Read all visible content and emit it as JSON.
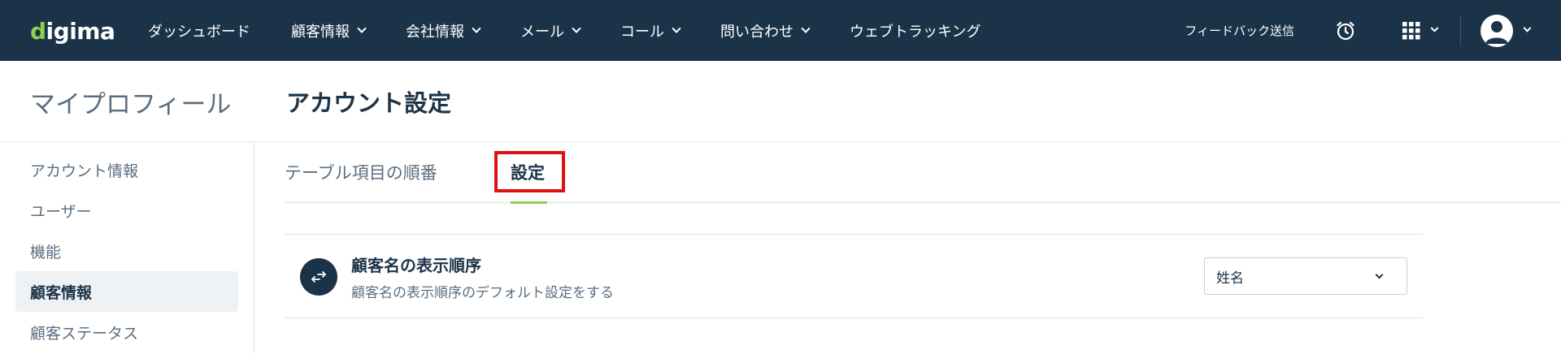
{
  "app": {
    "logo_prefix": "d",
    "logo_rest": "igima"
  },
  "topnav": {
    "items": [
      {
        "label": "ダッシュボード",
        "dropdown": false
      },
      {
        "label": "顧客情報",
        "dropdown": true
      },
      {
        "label": "会社情報",
        "dropdown": true
      },
      {
        "label": "メール",
        "dropdown": true
      },
      {
        "label": "コール",
        "dropdown": true
      },
      {
        "label": "問い合わせ",
        "dropdown": true
      },
      {
        "label": "ウェブトラッキング",
        "dropdown": false
      }
    ],
    "feedback_label": "フィードバック送信",
    "icons": {
      "alarm": "alarm-clock-icon",
      "apps": "grid-apps-icon",
      "avatar": "user-avatar-icon"
    }
  },
  "header": {
    "section_title": "マイプロフィール",
    "page_title": "アカウント設定"
  },
  "sidebar": {
    "items": [
      {
        "label": "アカウント情報",
        "active": false
      },
      {
        "label": "ユーザー",
        "active": false
      },
      {
        "label": "機能",
        "active": false
      },
      {
        "label": "顧客情報",
        "active": true
      },
      {
        "label": "顧客ステータス",
        "active": false
      }
    ]
  },
  "tabs": {
    "items": [
      {
        "label": "テーブル項目の順番",
        "active": false
      },
      {
        "label": "設定",
        "active": true
      }
    ]
  },
  "setting": {
    "title": "顧客名の表示順序",
    "description": "顧客名の表示順序のデフォルト設定をする",
    "select_value": "姓名",
    "icon": "swap-arrows-icon"
  },
  "colors": {
    "nav_bg": "#1b3349",
    "accent_green": "#8fd14f",
    "highlight_red": "#e01010"
  }
}
